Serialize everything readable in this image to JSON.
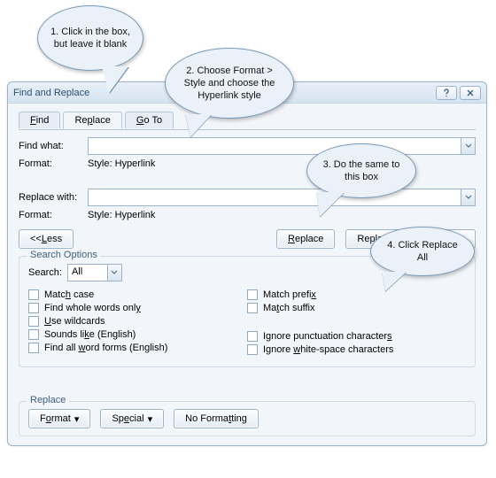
{
  "dialog": {
    "title": "Find and Replace"
  },
  "tabs": {
    "find": "Find",
    "replace": "Replace",
    "goto": "Go To",
    "active": "replace"
  },
  "find": {
    "label": "Find what:",
    "value": "",
    "format_label": "Format:",
    "format_value": "Style: Hyperlink"
  },
  "replace": {
    "label": "Replace with:",
    "value": "",
    "format_label": "Format:",
    "format_value": "Style: Hyperlink"
  },
  "buttons": {
    "less": "<< Less",
    "replace": "Replace",
    "replace_all": "Replace All",
    "format": "Format",
    "special": "Special",
    "no_formatting": "No Formatting"
  },
  "search_options": {
    "legend": "Search Options",
    "search_label": "Search:",
    "search_value": "All",
    "left": [
      "Match case",
      "Find whole words only",
      "Use wildcards",
      "Sounds like (English)",
      "Find all word forms (English)"
    ],
    "right": [
      "Match prefix",
      "Match suffix",
      "Ignore punctuation characters",
      "Ignore white-space characters"
    ]
  },
  "replace_section": {
    "legend": "Replace"
  },
  "callouts": {
    "c1": "1. Click in the box, but leave it blank",
    "c2": "2. Choose Format > Style and choose the Hyperlink style",
    "c3": "3. Do the same to this box",
    "c4": "4. Click Replace All"
  }
}
